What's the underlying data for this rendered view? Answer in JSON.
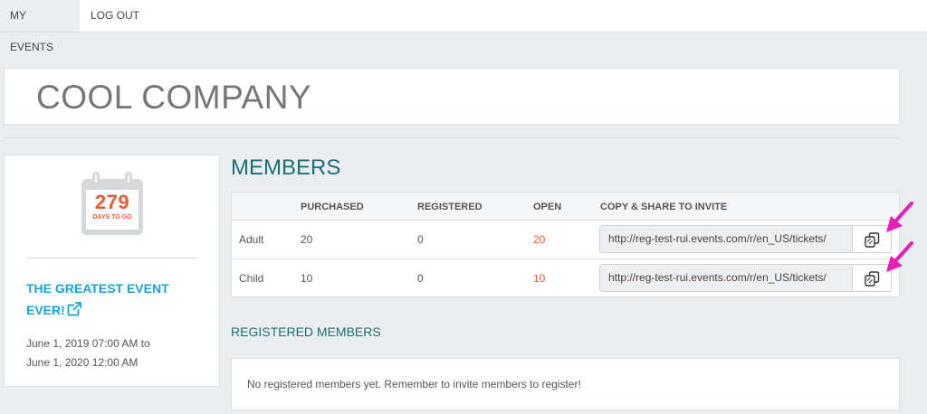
{
  "nav": {
    "tabs": [
      {
        "label": "MY EVENTS",
        "active": true
      },
      {
        "label": "LOG OUT",
        "active": false
      }
    ]
  },
  "company": {
    "name": "COOL COMPANY"
  },
  "event": {
    "days_count": "279",
    "days_label": "DAYS TO GO",
    "title": "THE GREATEST EVENT EVER!",
    "dates": [
      "June 1, 2019 07:00 AM to",
      "June 1, 2020 12:00 AM"
    ]
  },
  "members": {
    "title": "MEMBERS",
    "columns": [
      "",
      "PURCHASED",
      "REGISTERED",
      "OPEN",
      "COPY & SHARE TO INVITE"
    ],
    "rows": [
      {
        "type": "Adult",
        "purchased": "20",
        "registered": "0",
        "open": "20",
        "url": "http://reg-test-rui.events.com/r/en_US/tickets/"
      },
      {
        "type": "Child",
        "purchased": "10",
        "registered": "0",
        "open": "10",
        "url": "http://reg-test-rui.events.com/r/en_US/tickets/"
      }
    ]
  },
  "registered": {
    "title": "REGISTERED MEMBERS",
    "empty_message": "No registered members yet. Remember to invite members to register!"
  },
  "icons": {
    "calendar": "calendar-icon",
    "external_link": "external-link-icon",
    "copy": "copy-icon",
    "annotation_arrow": "arrow-icon"
  },
  "colors": {
    "accent_orange": "#ef5a2f",
    "heading_teal": "#1d6e76",
    "link_blue": "#1aa3d9",
    "annotation_magenta": "#e51fb8",
    "page_bg": "#ebeef0"
  }
}
